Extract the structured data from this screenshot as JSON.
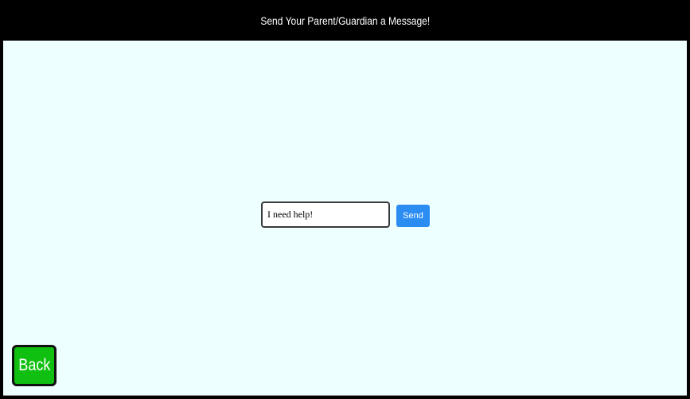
{
  "header": {
    "title": "Send Your Parent/Guardian a Message!"
  },
  "message_form": {
    "input_value": "I need help!",
    "send_label": "Send"
  },
  "navigation": {
    "back_label": "Back"
  },
  "colors": {
    "header_background": "#000000",
    "page_background": "#eeffff",
    "send_button": "#2b8cf2",
    "back_button": "#10c010"
  }
}
